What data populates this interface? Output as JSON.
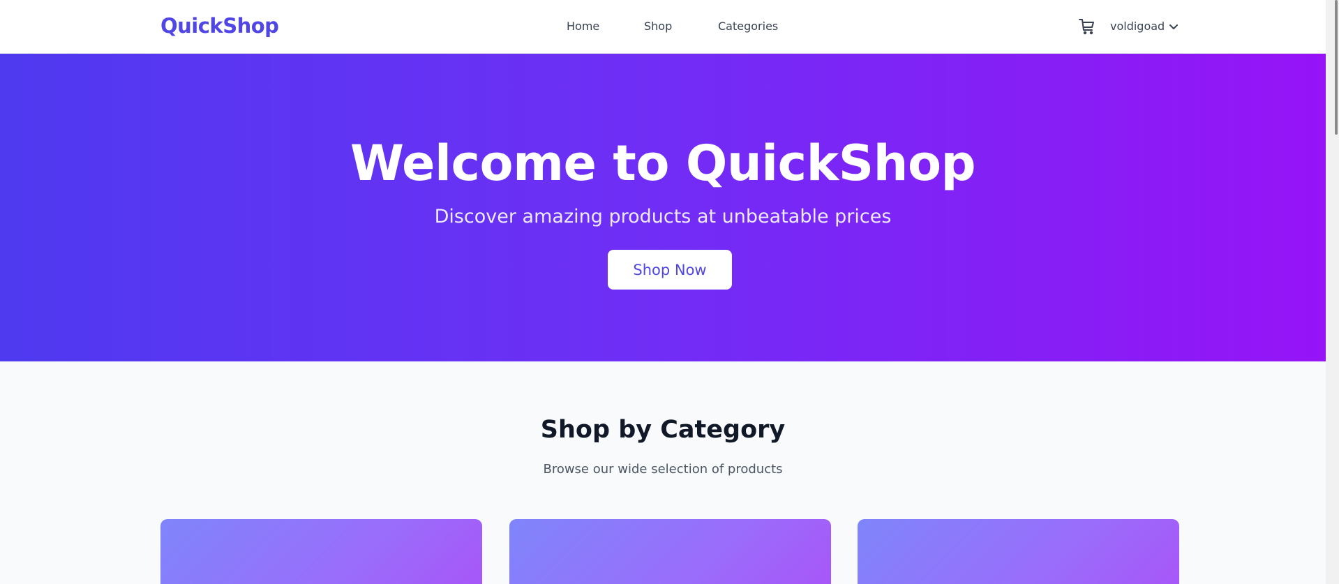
{
  "header": {
    "logo": "QuickShop",
    "nav": [
      {
        "label": "Home"
      },
      {
        "label": "Shop"
      },
      {
        "label": "Categories"
      }
    ],
    "cart_icon": "cart-icon",
    "user": {
      "name": "voldigoad",
      "icon": "chevron-down-icon"
    }
  },
  "hero": {
    "title": "Welcome to QuickShop",
    "subtitle": "Discover amazing products at unbeatable prices",
    "cta_label": "Shop Now"
  },
  "categories": {
    "title": "Shop by Category",
    "subtitle": "Browse our wide selection of products"
  },
  "colors": {
    "brand": "#4f46e5",
    "hero_gradient_start": "#4f3af0",
    "hero_gradient_end": "#9614f7",
    "card_gradient_start": "#7f85fb",
    "card_gradient_end": "#a855f7"
  }
}
